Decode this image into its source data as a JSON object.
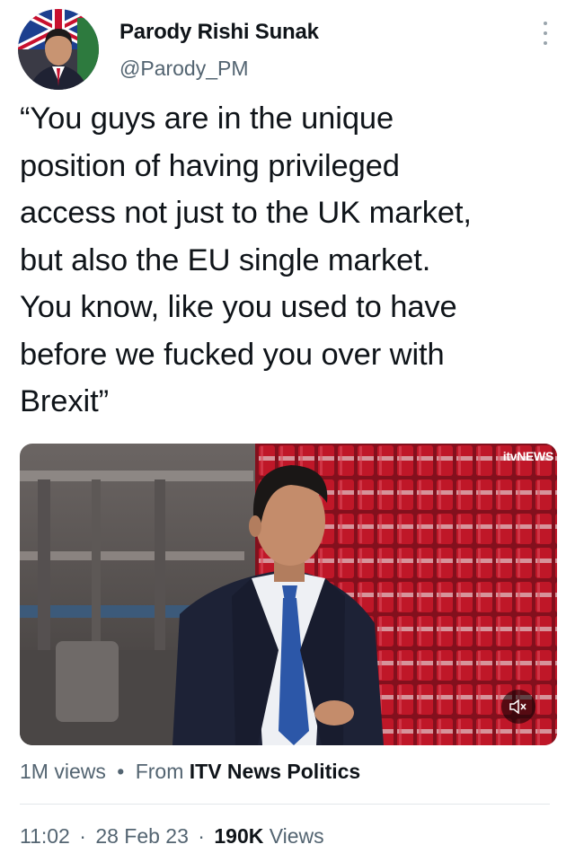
{
  "author": {
    "display_name": "Parody Rishi Sunak",
    "handle": "@Parody_PM",
    "avatar_icon": "profile-photo",
    "more_icon": "vertical-dots-icon"
  },
  "tweet": {
    "text": "“You guys are in the unique\nposition of having privileged\naccess not just to the UK market,\nbut also the EU single market.\nYou know, like you used to have\nbefore we fucked you over with\nBrexit”"
  },
  "video": {
    "watermark": "itvNEWS",
    "mute_icon": "speaker-muted-icon"
  },
  "views_line": {
    "views": "1M views",
    "separator": "•",
    "from_label": "From",
    "source": "ITV News Politics"
  },
  "meta": {
    "time": "11:02",
    "sep1": "·",
    "date": "28 Feb 23",
    "sep2": "·",
    "view_count": "190K",
    "view_label": "Views"
  },
  "colors": {
    "text": "#0f1419",
    "secondary": "#536471",
    "divider": "#e3e7ea",
    "can_red": "#c8102e"
  }
}
